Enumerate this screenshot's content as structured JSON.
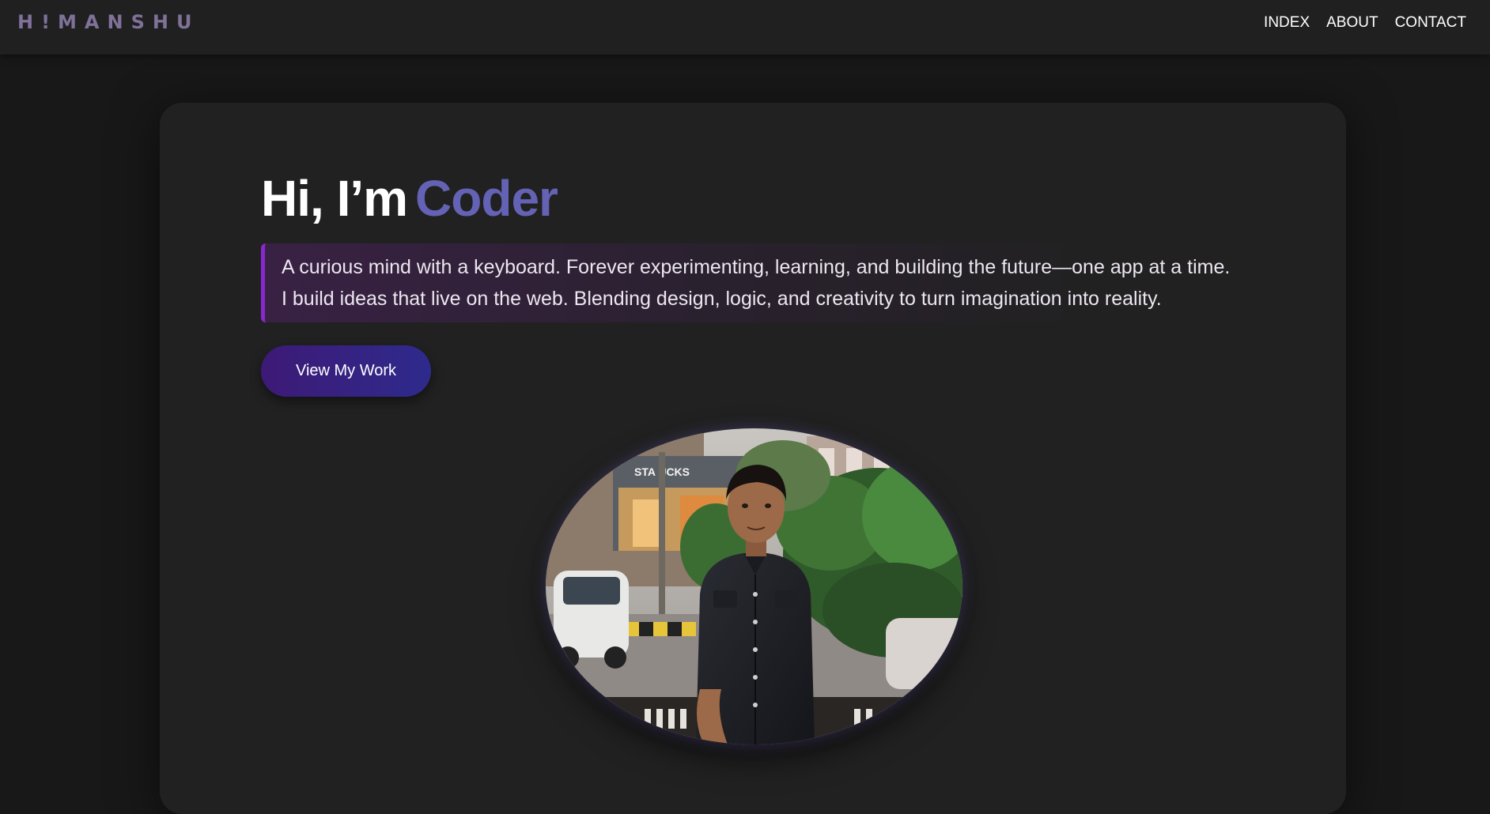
{
  "nav": {
    "logo": "H!MANSHU",
    "links": [
      "INDEX",
      "ABOUT",
      "CONTACT"
    ]
  },
  "hero": {
    "greeting": "Hi, I’m",
    "role": "Coder",
    "tagline_line1": "A curious mind with a keyboard. Forever experimenting, learning, and building the future—one app at a time.",
    "tagline_line2": "I build ideas that live on the web. Blending design, logic, and creativity to turn imagination into reality.",
    "cta_label": "View My Work"
  },
  "photo": {
    "storefront_sign": "STA UCKS"
  },
  "colors": {
    "accent": "#6462b4",
    "quote_border": "#8a28d0",
    "button_start": "#3d1a76",
    "button_end": "#2e2a8c",
    "logo": "#7f7199",
    "background": "#181818",
    "card": "#212121"
  }
}
